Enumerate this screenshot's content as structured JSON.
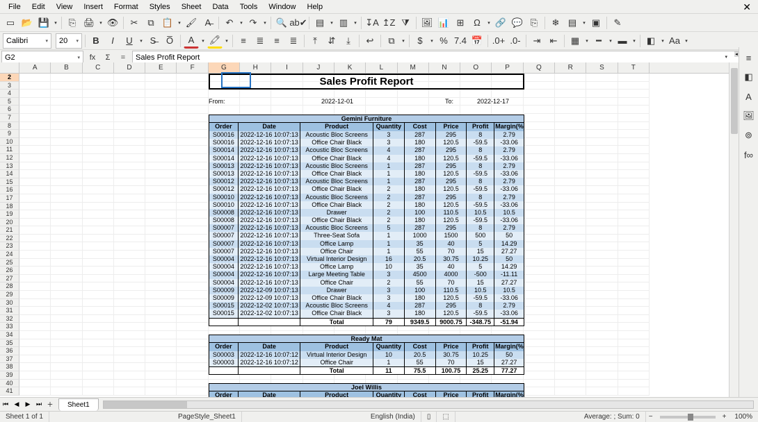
{
  "menu": [
    "File",
    "Edit",
    "View",
    "Insert",
    "Format",
    "Styles",
    "Sheet",
    "Data",
    "Tools",
    "Window",
    "Help"
  ],
  "window_close": "✕",
  "toolbar1_icons": [
    {
      "n": "new-icon",
      "g": "▭"
    },
    {
      "n": "open-icon",
      "g": "📂"
    },
    {
      "n": "save-icon",
      "g": "💾"
    },
    {
      "dd": true
    },
    {
      "sep": true
    },
    {
      "n": "export-pdf-icon",
      "g": "⎘"
    },
    {
      "n": "print-icon",
      "g": "🖨"
    },
    {
      "dd": true
    },
    {
      "n": "print-preview-icon",
      "g": "👁"
    },
    {
      "sep": true
    },
    {
      "n": "cut-icon",
      "g": "✂"
    },
    {
      "n": "copy-icon",
      "g": "⧉"
    },
    {
      "n": "paste-icon",
      "g": "📋"
    },
    {
      "dd": true
    },
    {
      "n": "clone-format-icon",
      "g": "🖌"
    },
    {
      "n": "clear-format-icon",
      "g": "A̶"
    },
    {
      "sep": true
    },
    {
      "n": "undo-icon",
      "g": "↶"
    },
    {
      "dd": true
    },
    {
      "n": "redo-icon",
      "g": "↷"
    },
    {
      "dd": true
    },
    {
      "sep": true
    },
    {
      "n": "find-icon",
      "g": "🔍"
    },
    {
      "n": "spellcheck-icon",
      "g": "ab✔"
    },
    {
      "sep": true
    },
    {
      "n": "row-icon",
      "g": "▤"
    },
    {
      "dd": true
    },
    {
      "n": "column-icon",
      "g": "▥"
    },
    {
      "dd": true
    },
    {
      "sep": true
    },
    {
      "n": "sort-asc-icon",
      "g": "↧A"
    },
    {
      "n": "sort-desc-icon",
      "g": "↥Z"
    },
    {
      "n": "autofilter-icon",
      "g": "⧩"
    },
    {
      "sep": true
    },
    {
      "n": "image-icon",
      "g": "🖼"
    },
    {
      "n": "chart-icon",
      "g": "📊"
    },
    {
      "n": "pivot-icon",
      "g": "⊞"
    },
    {
      "n": "specialchar-icon",
      "g": "Ω"
    },
    {
      "dd": true
    },
    {
      "n": "hyperlink-icon",
      "g": "🔗"
    },
    {
      "n": "comment-icon",
      "g": "💬"
    },
    {
      "n": "headerfooter-icon",
      "g": "⎘"
    },
    {
      "sep": true
    },
    {
      "n": "freeze-icon",
      "g": "❄"
    },
    {
      "n": "split-icon",
      "g": "▤"
    },
    {
      "dd": true
    },
    {
      "n": "window-icon",
      "g": "▣"
    },
    {
      "sep": true
    },
    {
      "n": "draw-icon",
      "g": "✎"
    }
  ],
  "font_name": "Calibri",
  "font_size": "20",
  "toolbar2_icons_a": [
    {
      "n": "bold-icon",
      "g": "B",
      "bold": true
    },
    {
      "n": "italic-icon",
      "g": "I",
      "italic": true
    },
    {
      "n": "underline-icon",
      "g": "U",
      "ul": true
    },
    {
      "dd": true
    },
    {
      "n": "strike-icon",
      "g": "S̶"
    },
    {
      "n": "overline-icon",
      "g": "O̅"
    }
  ],
  "toolbar2_icons_b": [
    {
      "n": "font-color-icon",
      "g": "A",
      "bar": "#c33"
    },
    {
      "dd": true
    },
    {
      "n": "highlight-icon",
      "g": "🖍",
      "bar": "#fd0"
    },
    {
      "dd": true
    }
  ],
  "toolbar2_icons_c": [
    {
      "n": "align-left-icon",
      "g": "≡"
    },
    {
      "n": "align-center-icon",
      "g": "≣"
    },
    {
      "n": "align-right-icon",
      "g": "≡"
    },
    {
      "n": "justify-icon",
      "g": "≣"
    },
    {
      "sep": true
    },
    {
      "n": "align-top-icon",
      "g": "⤒"
    },
    {
      "n": "align-middle-icon",
      "g": "⇵"
    },
    {
      "n": "align-bottom-icon",
      "g": "⤓"
    },
    {
      "sep": true
    },
    {
      "n": "wrap-icon",
      "g": "↩"
    },
    {
      "sep": true
    },
    {
      "n": "merge-icon",
      "g": "⧉"
    },
    {
      "dd": true
    },
    {
      "sep": true
    },
    {
      "n": "currency-icon",
      "g": "$"
    },
    {
      "dd": true
    },
    {
      "n": "percent-icon",
      "g": "%"
    },
    {
      "n": "number-icon",
      "g": "7.4"
    },
    {
      "n": "date-icon",
      "g": "📅"
    },
    {
      "sep": true
    },
    {
      "n": "add-decimal-icon",
      "g": ".0+"
    },
    {
      "n": "remove-decimal-icon",
      "g": ".0-"
    },
    {
      "sep": true
    },
    {
      "n": "increase-indent-icon",
      "g": "⇥"
    },
    {
      "n": "decrease-indent-icon",
      "g": "⇤"
    },
    {
      "sep": true
    },
    {
      "n": "borders-icon",
      "g": "▦"
    },
    {
      "dd": true
    },
    {
      "n": "border-style-icon",
      "g": "━"
    },
    {
      "dd": true
    },
    {
      "n": "border-color-icon",
      "g": "▬"
    },
    {
      "dd": true
    },
    {
      "sep": true
    },
    {
      "n": "cond-format-icon",
      "g": "◧"
    },
    {
      "dd": true
    },
    {
      "n": "cell-style-icon",
      "g": "Aa"
    },
    {
      "dd": true
    }
  ],
  "name_box": "G2",
  "fb_buttons": [
    {
      "n": "function-wizard-icon",
      "g": "fx"
    },
    {
      "n": "sum-icon",
      "g": "Σ"
    },
    {
      "n": "formula-icon",
      "g": "="
    }
  ],
  "formula_content": "Sales Profit Report",
  "sidebar_icons": [
    {
      "n": "sidebar-menu-icon",
      "g": "≡"
    },
    {
      "n": "properties-icon",
      "g": "◧"
    },
    {
      "n": "styles-icon",
      "g": "A"
    },
    {
      "n": "gallery-icon",
      "g": "🖼"
    },
    {
      "n": "navigator-icon",
      "g": "⊚"
    },
    {
      "n": "functions-icon",
      "g": "f∞"
    }
  ],
  "columns": [
    "A",
    "B",
    "C",
    "D",
    "E",
    "F",
    "G",
    "H",
    "I",
    "J",
    "K",
    "L",
    "M",
    "N",
    "O",
    "P",
    "Q",
    "R",
    "S",
    "T"
  ],
  "active_col_index": 6,
  "row_numbers_start": 2,
  "row_numbers_end": 41,
  "active_row": 2,
  "report": {
    "title": "Sales Profit Report",
    "from_label": "From:",
    "from_date": "2022-12-01",
    "to_label": "To:",
    "to_date": "2022-12-17",
    "headers": [
      "Order",
      "Date",
      "Product",
      "Quantity",
      "Cost",
      "Price",
      "Profit",
      "Margin(%)"
    ],
    "total_label": "Total",
    "sections": [
      {
        "name": "Gemini Furniture",
        "rows": [
          [
            "S00016",
            "2022-12-16 10:07:13",
            "Acoustic Bloc Screens",
            "3",
            "287",
            "295",
            "8",
            "2.79"
          ],
          [
            "S00016",
            "2022-12-16 10:07:13",
            "Office Chair Black",
            "3",
            "180",
            "120.5",
            "-59.5",
            "-33.06"
          ],
          [
            "S00014",
            "2022-12-16 10:07:13",
            "Acoustic Bloc Screens",
            "4",
            "287",
            "295",
            "8",
            "2.79"
          ],
          [
            "S00014",
            "2022-12-16 10:07:13",
            "Office Chair Black",
            "4",
            "180",
            "120.5",
            "-59.5",
            "-33.06"
          ],
          [
            "S00013",
            "2022-12-16 10:07:13",
            "Acoustic Bloc Screens",
            "1",
            "287",
            "295",
            "8",
            "2.79"
          ],
          [
            "S00013",
            "2022-12-16 10:07:13",
            "Office Chair Black",
            "1",
            "180",
            "120.5",
            "-59.5",
            "-33.06"
          ],
          [
            "S00012",
            "2022-12-16 10:07:13",
            "Acoustic Bloc Screens",
            "1",
            "287",
            "295",
            "8",
            "2.79"
          ],
          [
            "S00012",
            "2022-12-16 10:07:13",
            "Office Chair Black",
            "2",
            "180",
            "120.5",
            "-59.5",
            "-33.06"
          ],
          [
            "S00010",
            "2022-12-16 10:07:13",
            "Acoustic Bloc Screens",
            "2",
            "287",
            "295",
            "8",
            "2.79"
          ],
          [
            "S00010",
            "2022-12-16 10:07:13",
            "Office Chair Black",
            "2",
            "180",
            "120.5",
            "-59.5",
            "-33.06"
          ],
          [
            "S00008",
            "2022-12-16 10:07:13",
            "Drawer",
            "2",
            "100",
            "110.5",
            "10.5",
            "10.5"
          ],
          [
            "S00008",
            "2022-12-16 10:07:13",
            "Office Chair Black",
            "2",
            "180",
            "120.5",
            "-59.5",
            "-33.06"
          ],
          [
            "S00007",
            "2022-12-16 10:07:13",
            "Acoustic Bloc Screens",
            "5",
            "287",
            "295",
            "8",
            "2.79"
          ],
          [
            "S00007",
            "2022-12-16 10:07:13",
            "Three-Seat Sofa",
            "1",
            "1000",
            "1500",
            "500",
            "50"
          ],
          [
            "S00007",
            "2022-12-16 10:07:13",
            "Office Lamp",
            "1",
            "35",
            "40",
            "5",
            "14.29"
          ],
          [
            "S00007",
            "2022-12-16 10:07:13",
            "Office Chair",
            "1",
            "55",
            "70",
            "15",
            "27.27"
          ],
          [
            "S00004",
            "2022-12-16 10:07:13",
            "Virtual Interior Design",
            "16",
            "20.5",
            "30.75",
            "10.25",
            "50"
          ],
          [
            "S00004",
            "2022-12-16 10:07:13",
            "Office Lamp",
            "10",
            "35",
            "40",
            "5",
            "14.29"
          ],
          [
            "S00004",
            "2022-12-16 10:07:13",
            "Large Meeting Table",
            "3",
            "4500",
            "4000",
            "-500",
            "-11.11"
          ],
          [
            "S00004",
            "2022-12-16 10:07:13",
            "Office Chair",
            "2",
            "55",
            "70",
            "15",
            "27.27"
          ],
          [
            "S00009",
            "2022-12-09 10:07:13",
            "Drawer",
            "3",
            "100",
            "110.5",
            "10.5",
            "10.5"
          ],
          [
            "S00009",
            "2022-12-09 10:07:13",
            "Office Chair Black",
            "3",
            "180",
            "120.5",
            "-59.5",
            "-33.06"
          ],
          [
            "S00015",
            "2022-12-02 10:07:13",
            "Acoustic Bloc Screens",
            "4",
            "287",
            "295",
            "8",
            "2.79"
          ],
          [
            "S00015",
            "2022-12-02 10:07:13",
            "Office Chair Black",
            "3",
            "180",
            "120.5",
            "-59.5",
            "-33.06"
          ]
        ],
        "total": [
          "",
          "",
          "Total",
          "79",
          "9349.5",
          "9000.75",
          "-348.75",
          "-51.94"
        ]
      },
      {
        "name": "Ready Mat",
        "rows": [
          [
            "S00003",
            "2022-12-16 10:07:12",
            "Virtual Interior Design",
            "10",
            "20.5",
            "30.75",
            "10.25",
            "50"
          ],
          [
            "S00003",
            "2022-12-16 10:07:12",
            "Office Chair",
            "1",
            "55",
            "70",
            "15",
            "27.27"
          ]
        ],
        "total": [
          "",
          "",
          "Total",
          "11",
          "75.5",
          "100.75",
          "25.25",
          "77.27"
        ]
      },
      {
        "name": "Joel Willis",
        "rows": [],
        "total": null
      }
    ]
  },
  "sheet_tabs": {
    "nav": [
      "⏮",
      "◀",
      "▶",
      "⏭",
      "＋"
    ],
    "tabs": [
      "Sheet1"
    ]
  },
  "status": {
    "sheet": "Sheet 1 of 1",
    "pagestyle": "PageStyle_Sheet1",
    "lang": "English (India)",
    "overwrite": "▯",
    "selection": "⬚",
    "stats": "Average: ; Sum: 0",
    "zoom_minus": "−",
    "zoom_plus": "+",
    "zoom_pct": "100%"
  }
}
